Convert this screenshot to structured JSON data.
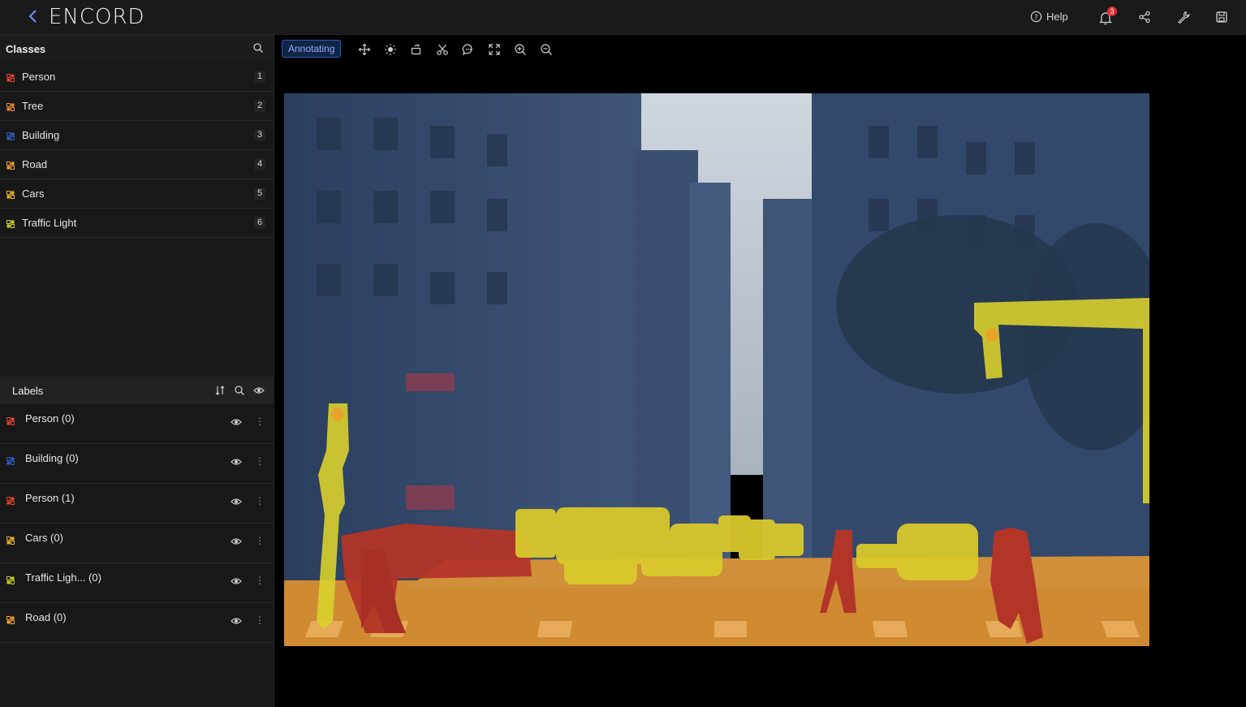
{
  "topbar": {
    "logo": "ENCORD",
    "help_label": "Help",
    "notification_count": "3"
  },
  "classes": {
    "title": "Classes",
    "items": [
      {
        "label": "Person",
        "key": "1",
        "color": "#e0422e"
      },
      {
        "label": "Tree",
        "key": "2",
        "color": "#e8862e"
      },
      {
        "label": "Building",
        "key": "3",
        "color": "#2b5cc0"
      },
      {
        "label": "Road",
        "key": "4",
        "color": "#f0a030"
      },
      {
        "label": "Cars",
        "key": "5",
        "color": "#e8b52e"
      },
      {
        "label": "Traffic Light",
        "key": "6",
        "color": "#c8cf2e"
      }
    ]
  },
  "labels": {
    "title": "Labels",
    "items": [
      {
        "label": "Person (0)",
        "color": "#e0422e"
      },
      {
        "label": "Building (0)",
        "color": "#2b5cc0"
      },
      {
        "label": "Person (1)",
        "color": "#e0422e"
      },
      {
        "label": "Cars (0)",
        "color": "#e8b52e"
      },
      {
        "label": "Traffic Ligh... (0)",
        "color": "#c8cf2e"
      },
      {
        "label": "Road (0)",
        "color": "#f0a030"
      }
    ]
  },
  "toolbar": {
    "mode_label": "Annotating",
    "tools": [
      "move-icon",
      "brightness-icon",
      "rotate-icon",
      "cut-icon",
      "comment-icon",
      "fit-screen-icon",
      "zoom-in-icon",
      "zoom-out-icon"
    ]
  },
  "canvas": {
    "image_description_name": "segmented-street-scene"
  }
}
